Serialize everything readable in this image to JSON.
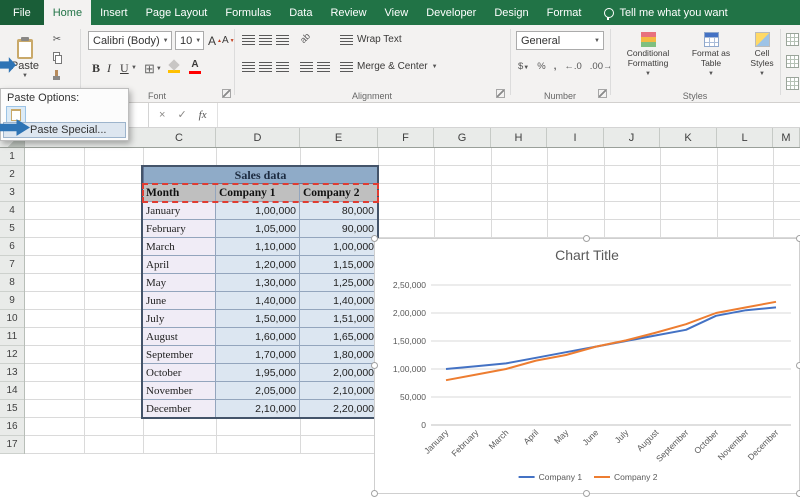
{
  "colors": {
    "excel_green": "#217346",
    "series1": "#4472c4",
    "series2": "#ed7d31"
  },
  "titlebar": {
    "tabs": [
      "File",
      "Home",
      "Insert",
      "Page Layout",
      "Formulas",
      "Data",
      "Review",
      "View",
      "Developer",
      "Design",
      "Format"
    ],
    "active_tab": "Home",
    "tell_me": "Tell me what you want"
  },
  "ribbon": {
    "paste": {
      "label": "Paste"
    },
    "font": {
      "family": "Calibri (Body)",
      "size": "10",
      "bold": "B",
      "italic": "I",
      "underline": "U"
    },
    "alignment": {
      "wrap_text": "Wrap Text",
      "merge_center": "Merge & Center"
    },
    "number": {
      "format": "General"
    },
    "styles": {
      "conditional": "Conditional Formatting",
      "format_table": "Format as Table",
      "cell_styles": "Cell Styles"
    },
    "group_labels": [
      "Font",
      "Alignment",
      "Number",
      "Styles"
    ]
  },
  "formula_bar": {
    "cancel": "×",
    "enter": "✓",
    "fx": "fx"
  },
  "paste_menu": {
    "title": "Paste Options:",
    "special": "Paste Special..."
  },
  "sheet": {
    "visible_columns": [
      "C",
      "D",
      "E",
      "F",
      "G",
      "H",
      "I",
      "J",
      "K",
      "L",
      "M"
    ],
    "visible_rows": 17,
    "table": {
      "title": "Sales data",
      "headers": [
        "Month",
        "Company 1",
        "Company 2"
      ],
      "rows": [
        [
          "January",
          "1,00,000",
          "80,000"
        ],
        [
          "February",
          "1,05,000",
          "90,000"
        ],
        [
          "March",
          "1,10,000",
          "1,00,000"
        ],
        [
          "April",
          "1,20,000",
          "1,15,000"
        ],
        [
          "May",
          "1,30,000",
          "1,25,000"
        ],
        [
          "June",
          "1,40,000",
          "1,40,000"
        ],
        [
          "July",
          "1,50,000",
          "1,51,000"
        ],
        [
          "August",
          "1,60,000",
          "1,65,000"
        ],
        [
          "September",
          "1,70,000",
          "1,80,000"
        ],
        [
          "October",
          "1,95,000",
          "2,00,000"
        ],
        [
          "November",
          "2,05,000",
          "2,10,000"
        ],
        [
          "December",
          "2,10,000",
          "2,20,000"
        ]
      ]
    }
  },
  "chart_data": {
    "type": "line",
    "title": "Chart Title",
    "categories": [
      "January",
      "February",
      "March",
      "April",
      "May",
      "June",
      "July",
      "August",
      "September",
      "October",
      "November",
      "December"
    ],
    "series": [
      {
        "name": "Company 1",
        "color": "#4472c4",
        "values": [
          100000,
          105000,
          110000,
          120000,
          130000,
          140000,
          150000,
          160000,
          170000,
          195000,
          205000,
          210000
        ]
      },
      {
        "name": "Company 2",
        "color": "#ed7d31",
        "values": [
          80000,
          90000,
          100000,
          115000,
          125000,
          140000,
          151000,
          165000,
          180000,
          200000,
          210000,
          220000
        ]
      }
    ],
    "ylim": [
      0,
      250000
    ],
    "ytick_labels": [
      "0",
      "50,000",
      "1,00,000",
      "1,50,000",
      "2,00,000",
      "2,50,000"
    ],
    "xlabel": "",
    "ylabel": "",
    "grid": true,
    "legend_position": "bottom"
  }
}
